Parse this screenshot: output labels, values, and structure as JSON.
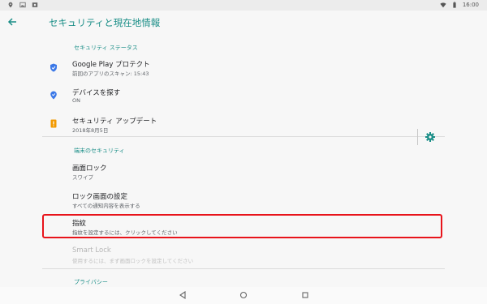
{
  "status_bar": {
    "time": "16:00"
  },
  "app_bar": {
    "title": "セキュリティと現在地情報"
  },
  "sections": {
    "security_status": "セキュリティ ステータス",
    "device_security": "端末のセキュリティ",
    "privacy": "プライバシー"
  },
  "items": {
    "play_protect": {
      "title": "Google Play プロテクト",
      "subtitle": "前回のアプリのスキャン: 15:43"
    },
    "find_device": {
      "title": "デバイスを探す",
      "subtitle": "ON"
    },
    "security_update": {
      "title": "セキュリティ アップデート",
      "subtitle": "2018年8月5日"
    },
    "screen_lock": {
      "title": "画面ロック",
      "subtitle": "スワイプ"
    },
    "lock_screen_settings": {
      "title": "ロック画面の設定",
      "subtitle": "すべての通知内容を表示する"
    },
    "fingerprint": {
      "title": "指紋",
      "subtitle": "指紋を設定するには、クリックしてください"
    },
    "smart_lock": {
      "title": "Smart Lock",
      "subtitle": "使用するには、まず画面ロックを設定してください"
    }
  },
  "colors": {
    "accent": "#1a8e87",
    "highlight": "#e8141b",
    "shield": "#3b78e7",
    "update": "#f29900"
  },
  "icons": {
    "back": "arrow-left-icon",
    "play_protect": "shield-check-icon",
    "find_device": "location-pin-icon",
    "security_update": "phone-update-icon",
    "settings": "gear-icon"
  }
}
